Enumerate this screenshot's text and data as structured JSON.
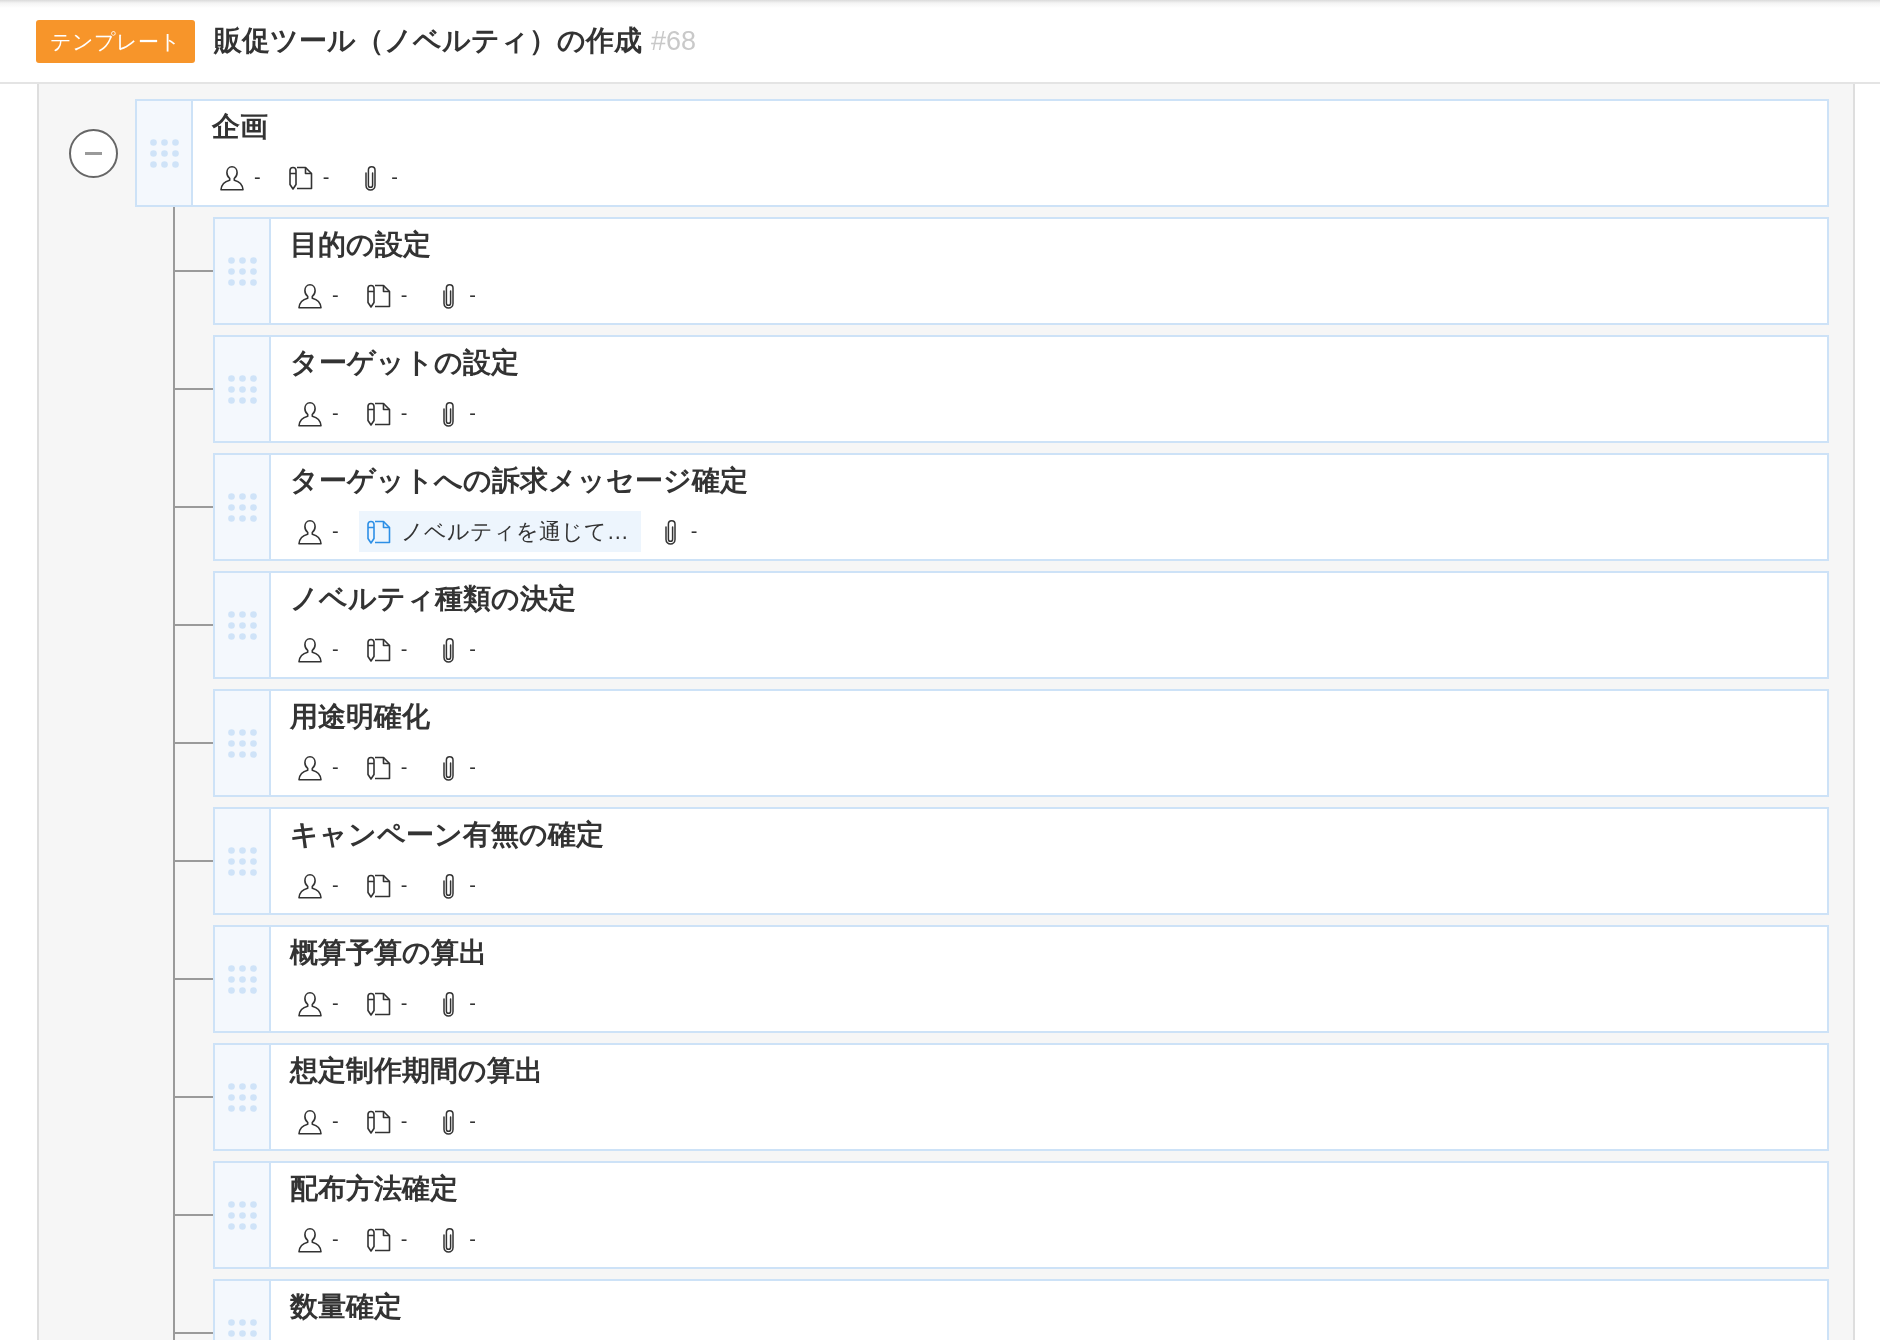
{
  "header": {
    "badge": "テンプレート",
    "title": "販促ツール（ノベルティ）の作成",
    "number": "#68"
  },
  "tree": {
    "title": "企画",
    "expanded": true,
    "assignee": "-",
    "document": {
      "text": "-",
      "linked": false
    },
    "attachment": "-",
    "children": [
      {
        "title": "目的の設定",
        "assignee": "-",
        "document": {
          "text": "-",
          "linked": false
        },
        "attachment": "-"
      },
      {
        "title": "ターゲットの設定",
        "assignee": "-",
        "document": {
          "text": "-",
          "linked": false
        },
        "attachment": "-"
      },
      {
        "title": "ターゲットへの訴求メッセージ確定",
        "assignee": "-",
        "document": {
          "text": "ノベルティを通じて…",
          "linked": true
        },
        "attachment": "-"
      },
      {
        "title": "ノベルティ種類の決定",
        "assignee": "-",
        "document": {
          "text": "-",
          "linked": false
        },
        "attachment": "-"
      },
      {
        "title": "用途明確化",
        "assignee": "-",
        "document": {
          "text": "-",
          "linked": false
        },
        "attachment": "-"
      },
      {
        "title": "キャンペーン有無の確定",
        "assignee": "-",
        "document": {
          "text": "-",
          "linked": false
        },
        "attachment": "-"
      },
      {
        "title": "概算予算の算出",
        "assignee": "-",
        "document": {
          "text": "-",
          "linked": false
        },
        "attachment": "-"
      },
      {
        "title": "想定制作期間の算出",
        "assignee": "-",
        "document": {
          "text": "-",
          "linked": false
        },
        "attachment": "-"
      },
      {
        "title": "配布方法確定",
        "assignee": "-",
        "document": {
          "text": "-",
          "linked": false
        },
        "attachment": "-"
      },
      {
        "title": "数量確定"
      }
    ]
  }
}
